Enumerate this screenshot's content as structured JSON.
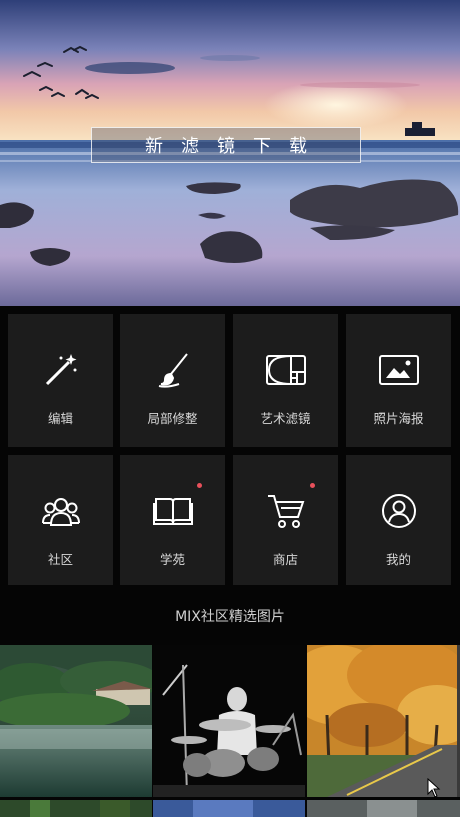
{
  "hero": {
    "button_label": "新滤镜下载"
  },
  "tools": [
    {
      "label": "编辑",
      "icon": "magic-wand-icon",
      "badge": false
    },
    {
      "label": "局部修整",
      "icon": "brush-icon",
      "badge": false
    },
    {
      "label": "艺术滤镜",
      "icon": "golden-ratio-icon",
      "badge": false
    },
    {
      "label": "照片海报",
      "icon": "poster-icon",
      "badge": false
    },
    {
      "label": "社区",
      "icon": "community-icon",
      "badge": false
    },
    {
      "label": "学苑",
      "icon": "book-icon",
      "badge": true
    },
    {
      "label": "商店",
      "icon": "cart-icon",
      "badge": true
    },
    {
      "label": "我的",
      "icon": "user-icon",
      "badge": false
    }
  ],
  "section": {
    "title": "MIX社区精选图片"
  },
  "photos": [
    "lake-forest-photo",
    "drummer-photo",
    "autumn-road-photo"
  ],
  "colors": {
    "tile_bg": "#1c1c1c",
    "badge": "#e8505b",
    "background": "#050505"
  }
}
